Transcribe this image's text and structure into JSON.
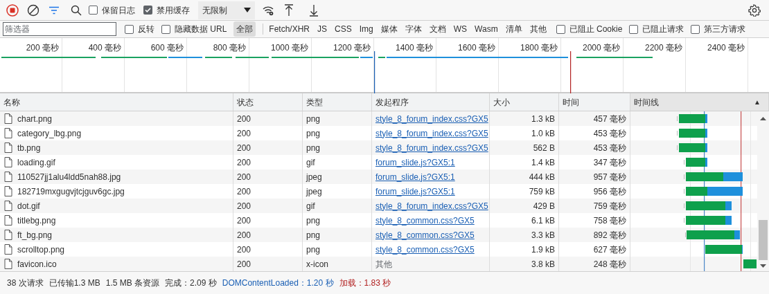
{
  "toolbar": {
    "recording": true,
    "checkboxes": [
      {
        "label": "保留日志",
        "checked": false
      },
      {
        "label": "禁用缓存",
        "checked": true
      }
    ],
    "throttle": "无限制"
  },
  "filter_bar": {
    "placeholder": "筛选器",
    "items": [
      {
        "kind": "checkbox",
        "label": "反转",
        "checked": false
      },
      {
        "kind": "checkbox",
        "label": "隐藏数据 URL",
        "checked": false
      },
      {
        "kind": "type",
        "label": "全部",
        "selected": true
      },
      {
        "kind": "separator"
      },
      {
        "kind": "type",
        "label": "Fetch/XHR",
        "selected": false
      },
      {
        "kind": "type",
        "label": "JS",
        "selected": false
      },
      {
        "kind": "type",
        "label": "CSS",
        "selected": false
      },
      {
        "kind": "type",
        "label": "Img",
        "selected": false
      },
      {
        "kind": "type",
        "label": "媒体",
        "selected": false
      },
      {
        "kind": "type",
        "label": "字体",
        "selected": false
      },
      {
        "kind": "type",
        "label": "文档",
        "selected": false
      },
      {
        "kind": "type",
        "label": "WS",
        "selected": false
      },
      {
        "kind": "type",
        "label": "Wasm",
        "selected": false
      },
      {
        "kind": "type",
        "label": "清单",
        "selected": false
      },
      {
        "kind": "type",
        "label": "其他",
        "selected": false
      },
      {
        "kind": "checkbox",
        "label": "已阻止 Cookie",
        "checked": false
      },
      {
        "kind": "checkbox",
        "label": "已阻止请求",
        "checked": false
      },
      {
        "kind": "checkbox",
        "label": "第三方请求",
        "checked": false
      }
    ]
  },
  "overview": {
    "ticks": [
      "200 毫秒",
      "400 毫秒",
      "600 毫秒",
      "800 毫秒",
      "1000 毫秒",
      "1200 毫秒",
      "1400 毫秒",
      "1600 毫秒",
      "1800 毫秒",
      "2000 毫秒",
      "2200 毫秒",
      "2400 毫秒"
    ]
  },
  "table": {
    "columns": [
      {
        "label": "名称",
        "sorted": false
      },
      {
        "label": "状态",
        "sorted": false
      },
      {
        "label": "类型",
        "sorted": false
      },
      {
        "label": "发起程序",
        "sorted": false
      },
      {
        "label": "大小",
        "sorted": false
      },
      {
        "label": "时间",
        "sorted": false
      },
      {
        "label": "时间线",
        "sorted": true,
        "sort_indicator": "▲"
      }
    ],
    "rows": [
      {
        "name": "chart.png",
        "status": "200",
        "type": "png",
        "initiator": {
          "kind": "link",
          "text": "style_8_forum_index.css?GX5"
        },
        "size": "1.3 kB",
        "time": "457 毫秒"
      },
      {
        "name": "category_lbg.png",
        "status": "200",
        "type": "png",
        "initiator": {
          "kind": "link",
          "text": "style_8_forum_index.css?GX5"
        },
        "size": "1.0 kB",
        "time": "453 毫秒"
      },
      {
        "name": "tb.png",
        "status": "200",
        "type": "png",
        "initiator": {
          "kind": "link",
          "text": "style_8_forum_index.css?GX5"
        },
        "size": "562 B",
        "time": "453 毫秒"
      },
      {
        "name": "loading.gif",
        "status": "200",
        "type": "gif",
        "initiator": {
          "kind": "link",
          "text": "forum_slide.js?GX5:1"
        },
        "size": "1.4 kB",
        "time": "347 毫秒"
      },
      {
        "name": "110527jj1alu4ldd5nah88.jpg",
        "status": "200",
        "type": "jpeg",
        "initiator": {
          "kind": "link",
          "text": "forum_slide.js?GX5:1"
        },
        "size": "444 kB",
        "time": "957 毫秒"
      },
      {
        "name": "182719mxgugvjtcjguv6gc.jpg",
        "status": "200",
        "type": "jpeg",
        "initiator": {
          "kind": "link",
          "text": "forum_slide.js?GX5:1"
        },
        "size": "759 kB",
        "time": "956 毫秒"
      },
      {
        "name": "dot.gif",
        "status": "200",
        "type": "gif",
        "initiator": {
          "kind": "link",
          "text": "style_8_forum_index.css?GX5"
        },
        "size": "429 B",
        "time": "759 毫秒"
      },
      {
        "name": "titlebg.png",
        "status": "200",
        "type": "png",
        "initiator": {
          "kind": "link",
          "text": "style_8_common.css?GX5"
        },
        "size": "6.1 kB",
        "time": "758 毫秒"
      },
      {
        "name": "ft_bg.png",
        "status": "200",
        "type": "png",
        "initiator": {
          "kind": "link",
          "text": "style_8_common.css?GX5"
        },
        "size": "3.3 kB",
        "time": "892 毫秒"
      },
      {
        "name": "scrolltop.png",
        "status": "200",
        "type": "png",
        "initiator": {
          "kind": "link",
          "text": "style_8_common.css?GX5"
        },
        "size": "1.9 kB",
        "time": "627 毫秒"
      },
      {
        "name": "favicon.ico",
        "status": "200",
        "type": "x-icon",
        "initiator": {
          "kind": "text",
          "text": "其他"
        },
        "size": "3.8 kB",
        "time": "248 毫秒"
      }
    ]
  },
  "status_bar": [
    {
      "kind": "plain",
      "text": "38 次请求"
    },
    {
      "kind": "plain",
      "text": "已传输1.3 MB"
    },
    {
      "kind": "plain",
      "text": "1.5 MB 条资源"
    },
    {
      "kind": "plain",
      "text": "完成：2.09 秒"
    },
    {
      "kind": "dom",
      "text": "DOMContentLoaded：1.20 秒"
    },
    {
      "kind": "load",
      "text": "加载：1.83 秒"
    }
  ]
}
